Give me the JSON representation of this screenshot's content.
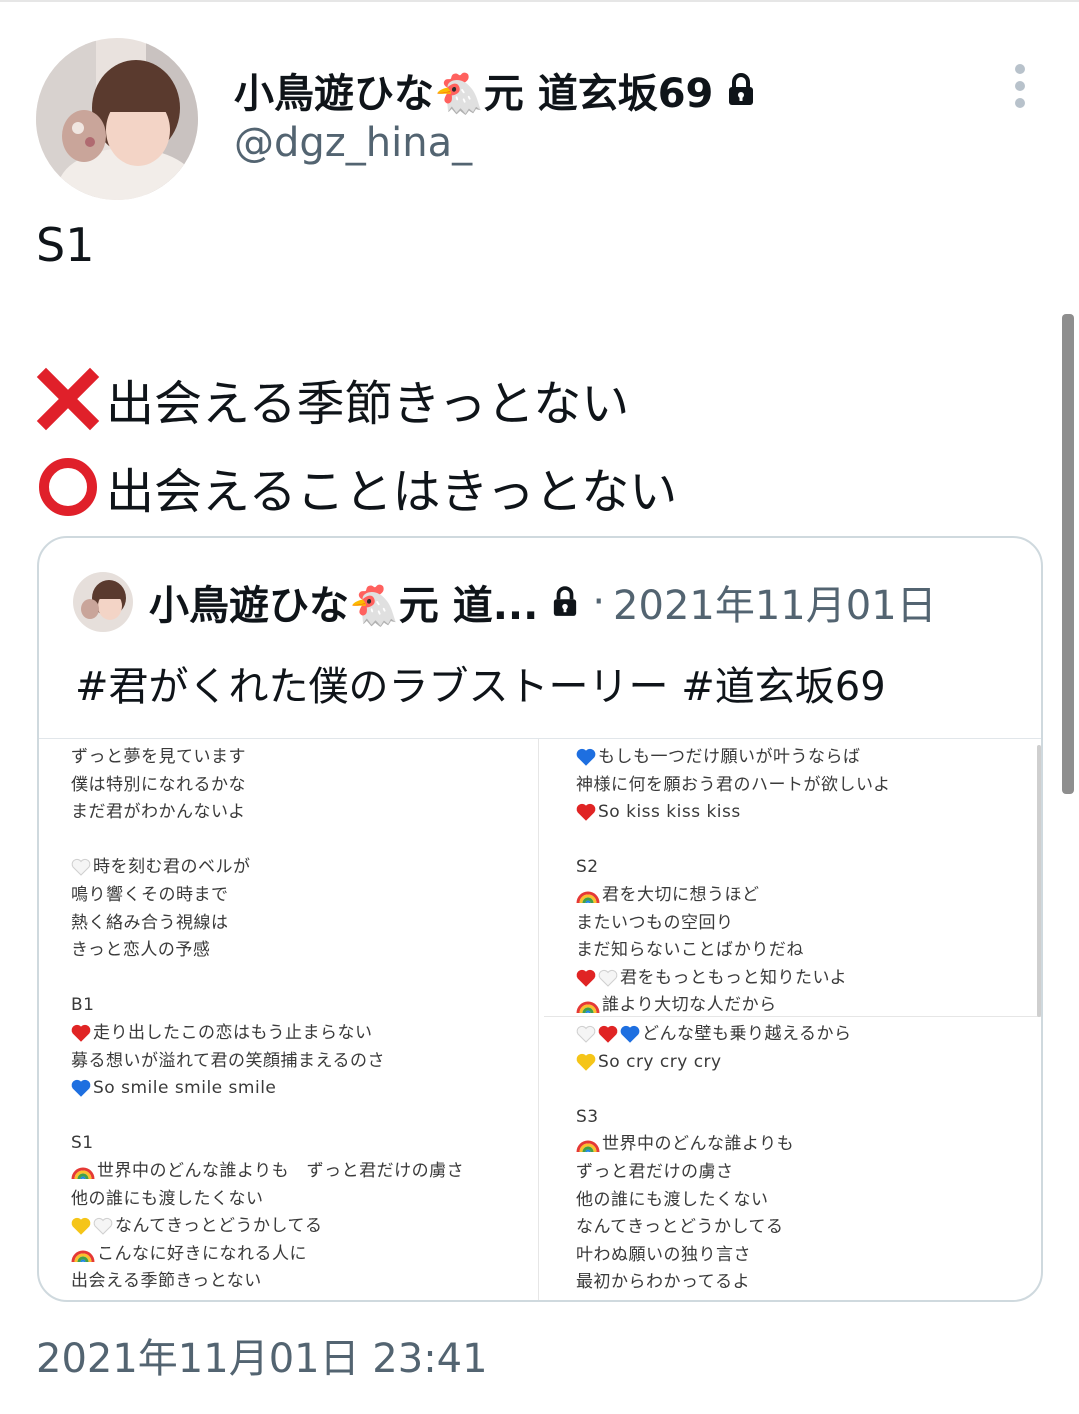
{
  "author": {
    "display_name": "小鳥遊ひな🐔元 道玄坂69",
    "handle": "@dgz_hina_"
  },
  "tweet": {
    "line1": "S1",
    "wrong_line": "出会える季節きっとない",
    "right_line": "出会えることはきっとない",
    "timestamp": "2021年11月01日 23:41"
  },
  "quote": {
    "display_name": "小鳥遊ひな🐔元 道...",
    "separator": "·",
    "date": "2021年11月01日",
    "text": "#君がくれた僕のラブストーリー  #道玄坂69",
    "left_lyrics": [
      {
        "icon": "",
        "text": "ずっと夢を見ています"
      },
      {
        "icon": "",
        "text": "僕は特別になれるかな"
      },
      {
        "icon": "",
        "text": "まだ君がわかんないよ"
      },
      {
        "icon": "",
        "text": ""
      },
      {
        "icon": "white-heart",
        "text": "時を刻む君のベルが"
      },
      {
        "icon": "",
        "text": "鳴り響くその時まで"
      },
      {
        "icon": "",
        "text": "熱く絡み合う視線は"
      },
      {
        "icon": "",
        "text": "きっと恋人の予感"
      },
      {
        "icon": "",
        "text": ""
      },
      {
        "icon": "",
        "text": "B1"
      },
      {
        "icon": "red-heart",
        "text": "走り出したこの恋はもう止まらない"
      },
      {
        "icon": "",
        "text": "募る想いが溢れて君の笑顔捕まえるのさ"
      },
      {
        "icon": "blue-heart",
        "text": "So smile smile smile"
      },
      {
        "icon": "",
        "text": ""
      },
      {
        "icon": "",
        "text": "S1"
      },
      {
        "icon": "rainbow",
        "text": "世界中のどんな誰よりも　ずっと君だけの虜さ"
      },
      {
        "icon": "",
        "text": "他の誰にも渡したくない"
      },
      {
        "icon": "yellow-white-heart",
        "text": "なんてきっとどうかしてる"
      },
      {
        "icon": "rainbow",
        "text": "こんなに好きになれる人に"
      },
      {
        "icon": "",
        "text": "出会える季節きっとない"
      }
    ],
    "right_lyrics_top": [
      {
        "icon": "blue-heart",
        "text": "もしも一つだけ願いが叶うならば"
      },
      {
        "icon": "",
        "text": "神様に何を願おう君のハートが欲しいよ"
      },
      {
        "icon": "red-heart",
        "text": "So kiss kiss kiss"
      },
      {
        "icon": "",
        "text": ""
      },
      {
        "icon": "",
        "text": "S2"
      },
      {
        "icon": "rainbow",
        "text": "君を大切に想うほど"
      },
      {
        "icon": "",
        "text": "またいつもの空回り"
      },
      {
        "icon": "",
        "text": "まだ知らないことばかりだね"
      },
      {
        "icon": "red-white-heart",
        "text": "君をもっともっと知りたいよ"
      },
      {
        "icon": "rainbow",
        "text": "誰より大切な人だから"
      }
    ],
    "right_lyrics_bottom": [
      {
        "icon": "white-red-blue-heart",
        "text": "どんな壁も乗り越えるから"
      },
      {
        "icon": "yellow-heart",
        "text": "So cry cry cry"
      },
      {
        "icon": "",
        "text": ""
      },
      {
        "icon": "",
        "text": "S3"
      },
      {
        "icon": "rainbow",
        "text": "世界中のどんな誰よりも"
      },
      {
        "icon": "",
        "text": "ずっと君だけの虜さ"
      },
      {
        "icon": "",
        "text": "他の誰にも渡したくない"
      },
      {
        "icon": "",
        "text": "なんてきっとどうかしてる"
      },
      {
        "icon": "",
        "text": "叶わぬ願いの独り言さ"
      },
      {
        "icon": "",
        "text": "最初からわかってるよ"
      }
    ]
  },
  "colors": {
    "text": "#0f1419",
    "secondary": "#536471",
    "border": "#cfd9de",
    "cross": "#e0202a",
    "circle": "#e0202a"
  },
  "icons": [
    "lock-icon",
    "more-options-icon",
    "cross-mark-icon",
    "circle-mark-icon",
    "heart-icons",
    "rainbow-icons"
  ]
}
